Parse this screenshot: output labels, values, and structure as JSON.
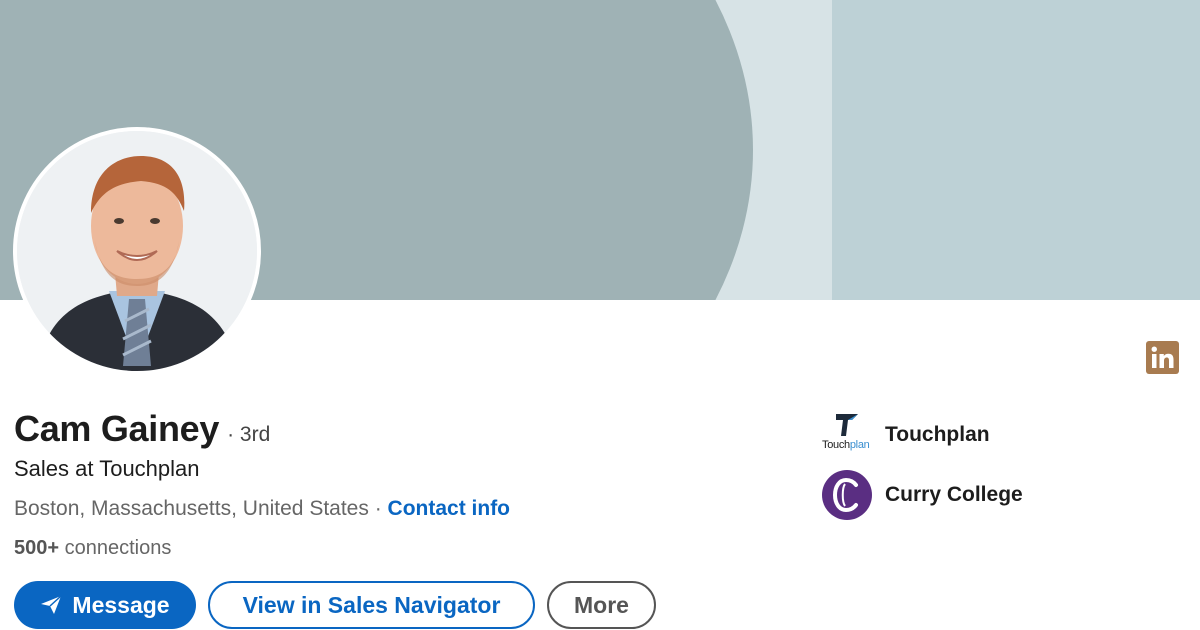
{
  "profile": {
    "name": "Cam Gainey",
    "degree": "· 3rd",
    "headline": "Sales at Touchplan",
    "location": "Boston, Massachusetts, United States",
    "separator": " · ",
    "contact_label": "Contact info",
    "connections_count": "500+",
    "connections_label": " connections"
  },
  "actions": {
    "message_label": "Message",
    "sales_nav_label": "View in Sales Navigator",
    "more_label": "More"
  },
  "organizations": [
    {
      "name": "Touchplan",
      "logo_text_a": "Touch",
      "logo_text_b": "plan",
      "icon": "touchplan-logo"
    },
    {
      "name": "Curry College",
      "icon": "curry-college-logo"
    }
  ],
  "colors": {
    "accent": "#0a66c2",
    "banner": "#9fb2b5",
    "linkedin_badge": "#a87b50",
    "curry": "#5a2e82"
  }
}
